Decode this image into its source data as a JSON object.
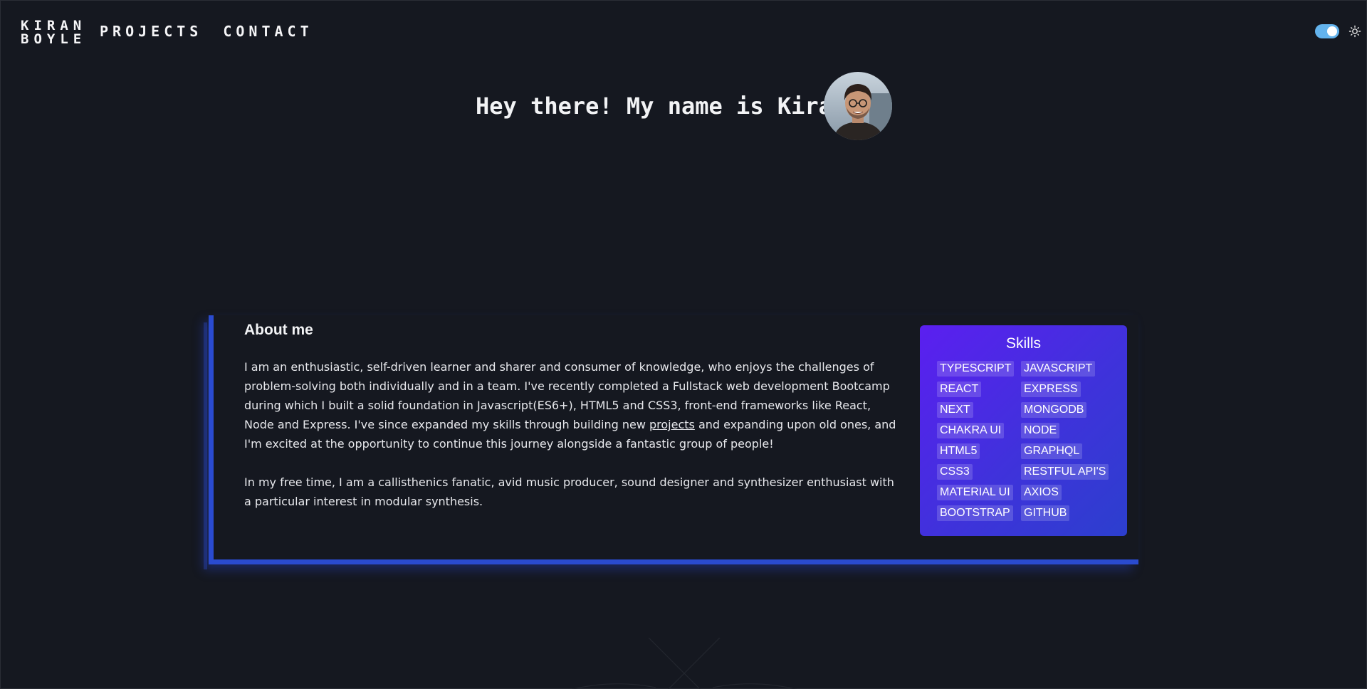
{
  "header": {
    "logo_line1": "KIRAN",
    "logo_line2": "BOYLE",
    "nav": [
      {
        "label": "PROJECTS"
      },
      {
        "label": "CONTACT"
      }
    ],
    "toggle_on": true,
    "theme_icon": "sun-icon"
  },
  "hero": {
    "title": "Hey there! My name is Kiran"
  },
  "about": {
    "heading": "About me",
    "para1_before": "I am an enthusiastic, self-driven learner and sharer and consumer of knowledge, who enjoys the challenges of problem-solving both individually and in a team. I've recently completed a Fullstack web development Bootcamp during which I built a solid foundation in Javascript(ES6+), HTML5 and CSS3, front-end frameworks like React, Node and Express. I've since expanded my skills through building new ",
    "para1_link": "projects",
    "para1_after": " and expanding upon old ones, and I'm excited at the opportunity to continue this journey alongside a fantastic group of people!",
    "para2": "In my free time, I am a callisthenics fanatic, avid music producer, sound designer and synthesizer enthusiast with a particular interest in modular synthesis."
  },
  "skills": {
    "title": "Skills",
    "items": [
      "TYPESCRIPT",
      "JAVASCRIPT",
      "REACT",
      "EXPRESS",
      "NEXT",
      "MONGODB",
      "CHAKRA UI",
      "NODE",
      "HTML5",
      "GRAPHQL",
      "CSS3",
      "RESTFUL API'S",
      "MATERIAL UI",
      "AXIOS",
      "BOOTSTRAP",
      "GITHUB"
    ]
  },
  "colors": {
    "background": "#151820",
    "accent_blue": "#2a4bd0",
    "skills_gradient_start": "#5b1ff0",
    "skills_gradient_end": "#2c3fce",
    "toggle": "#63b3ed"
  }
}
